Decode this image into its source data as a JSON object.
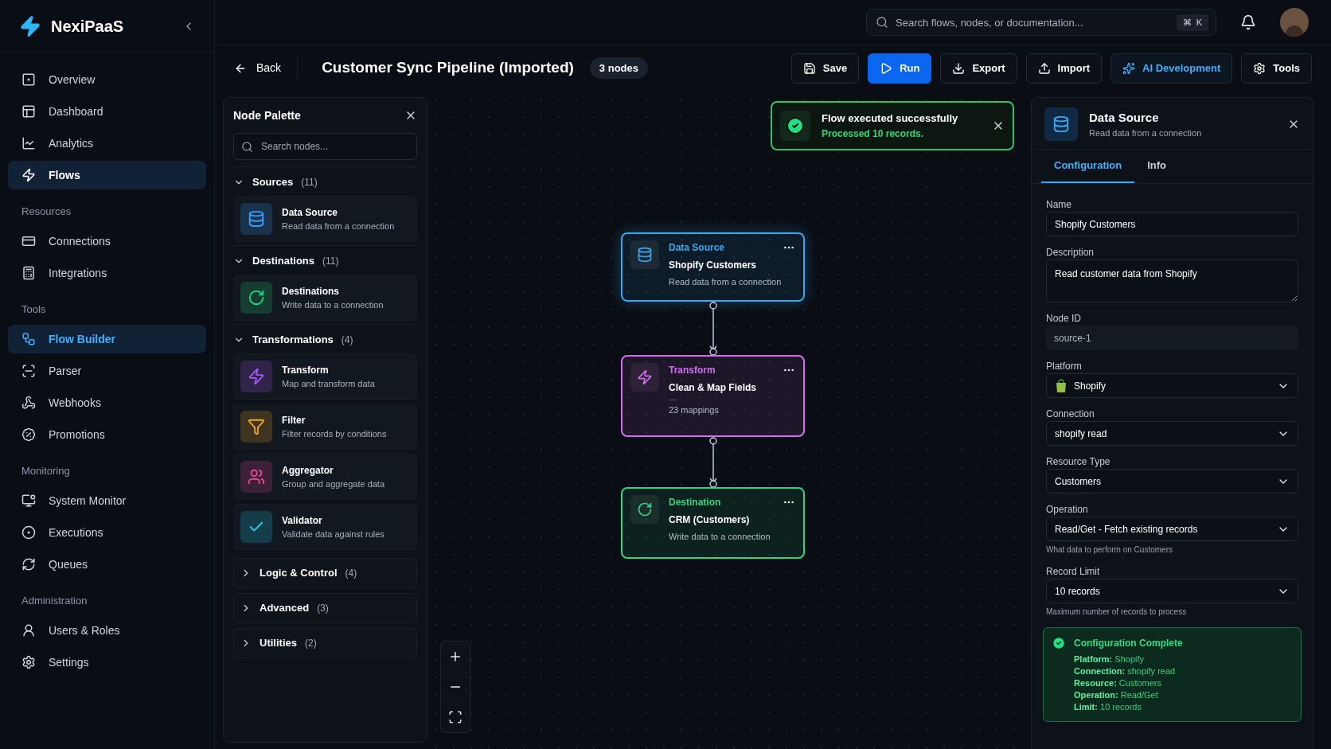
{
  "sidebar": {
    "brand": "NexiPaaS",
    "sections": [
      {
        "items": [
          {
            "label": "Overview",
            "selected": false
          },
          {
            "label": "Dashboard",
            "selected": false
          },
          {
            "label": "Analytics",
            "selected": false
          },
          {
            "label": "Flows",
            "selected": true
          }
        ]
      },
      {
        "heading": "Resources",
        "items": [
          {
            "label": "Connections",
            "selected": false
          },
          {
            "label": "Integrations",
            "selected": false
          }
        ]
      },
      {
        "heading": "Tools",
        "items": [
          {
            "label": "Flow Builder",
            "selected": true
          },
          {
            "label": "Parser",
            "selected": false
          },
          {
            "label": "Webhooks",
            "selected": false
          },
          {
            "label": "Promotions",
            "selected": false
          }
        ]
      },
      {
        "heading": "Monitoring",
        "items": [
          {
            "label": "System Monitor",
            "selected": false
          },
          {
            "label": "Executions",
            "selected": false
          },
          {
            "label": "Queues",
            "selected": false
          }
        ]
      },
      {
        "heading": "Administration",
        "items": [
          {
            "label": "Users & Roles",
            "selected": false
          },
          {
            "label": "Settings",
            "selected": false
          }
        ]
      }
    ]
  },
  "topbar": {
    "search": {
      "placeholder": "Search flows, nodes, or documentation..."
    },
    "shortcut": [
      "⌘",
      "K"
    ]
  },
  "toolbar": {
    "back": "Back",
    "title": "Customer Sync Pipeline (Imported)",
    "badge": "3 nodes",
    "buttons": [
      {
        "label": "Save",
        "kind": "default"
      },
      {
        "label": "Run",
        "kind": "primary"
      },
      {
        "label": "Export",
        "kind": "default"
      },
      {
        "label": "Import",
        "kind": "default"
      },
      {
        "label": "AI Development",
        "kind": "accent"
      },
      {
        "label": "Tools",
        "kind": "default"
      }
    ]
  },
  "palette": {
    "title": "Node Palette",
    "search": {
      "placeholder": "Search nodes..."
    },
    "groups": [
      {
        "label": "Sources",
        "count": "(11)",
        "expanded": true,
        "items": [
          {
            "title": "Data Source",
            "description": "Read data from a connection",
            "color": "#3b9eff"
          }
        ]
      },
      {
        "label": "Destinations",
        "count": "(11)",
        "expanded": true,
        "items": [
          {
            "title": "Destinations",
            "description": "Write data to a connection",
            "color": "#22d37f"
          }
        ]
      },
      {
        "label": "Transformations",
        "count": "(4)",
        "expanded": true,
        "items": [
          {
            "title": "Transform",
            "description": "Map and transform data",
            "color": "#a855f7"
          },
          {
            "title": "Filter",
            "description": "Filter records by conditions",
            "color": "#f5a524"
          },
          {
            "title": "Aggregator",
            "description": "Group and aggregate data",
            "color": "#ec4899"
          },
          {
            "title": "Validator",
            "description": "Validate data against rules",
            "color": "#22d3ee"
          }
        ]
      },
      {
        "label": "Logic & Control",
        "count": "(4)",
        "expanded": false
      },
      {
        "label": "Advanced",
        "count": "(3)",
        "expanded": false
      },
      {
        "label": "Utilities",
        "count": "(2)",
        "expanded": false
      }
    ]
  },
  "toast": {
    "title": "Flow executed successfully",
    "message": "Processed 10 records."
  },
  "nodes": [
    {
      "type": "Data Source",
      "name": "Shopify Customers",
      "detail": "Read data from a connection",
      "color": "#3ba7f0",
      "selected": true
    },
    {
      "type": "Transform",
      "name": "Clean & Map Fields",
      "detail": "23 mappings",
      "color": "#d46cf0",
      "selected": false
    },
    {
      "type": "Destination",
      "name": "CRM (Customers)",
      "detail": "Write data to a connection",
      "color": "#34d37f",
      "selected": false
    }
  ],
  "inspector": {
    "title": "Data Source",
    "subtitle": "Read data from a connection",
    "tabs": [
      {
        "label": "Configuration",
        "selected": true
      },
      {
        "label": "Info",
        "selected": false
      }
    ],
    "fields": [
      {
        "label": "Name",
        "kind": "text",
        "value": "Shopify Customers"
      },
      {
        "label": "Description",
        "kind": "textarea",
        "value": "Read customer data from Shopify"
      },
      {
        "label": "Node ID",
        "kind": "readonly",
        "value": "source-1"
      },
      {
        "label": "Platform",
        "kind": "select",
        "value": "Shopify",
        "logo": true
      },
      {
        "label": "Connection",
        "kind": "select",
        "value": "shopify read"
      },
      {
        "label": "Resource Type",
        "kind": "select",
        "value": "Customers"
      },
      {
        "label": "Operation",
        "kind": "select",
        "value": "Read/Get - Fetch existing records",
        "hint": "What data to perform on Customers"
      },
      {
        "label": "Record Limit",
        "kind": "select",
        "value": "10 records",
        "hint": "Maximum number of records to process"
      }
    ],
    "summary": {
      "title": "Configuration Complete",
      "lines": [
        "**Platform:** Shopify",
        "**Connection:** shopify read",
        "**Resource:** Customers",
        "**Operation:** Read/Get",
        "**Limit:** 10 records"
      ]
    }
  }
}
